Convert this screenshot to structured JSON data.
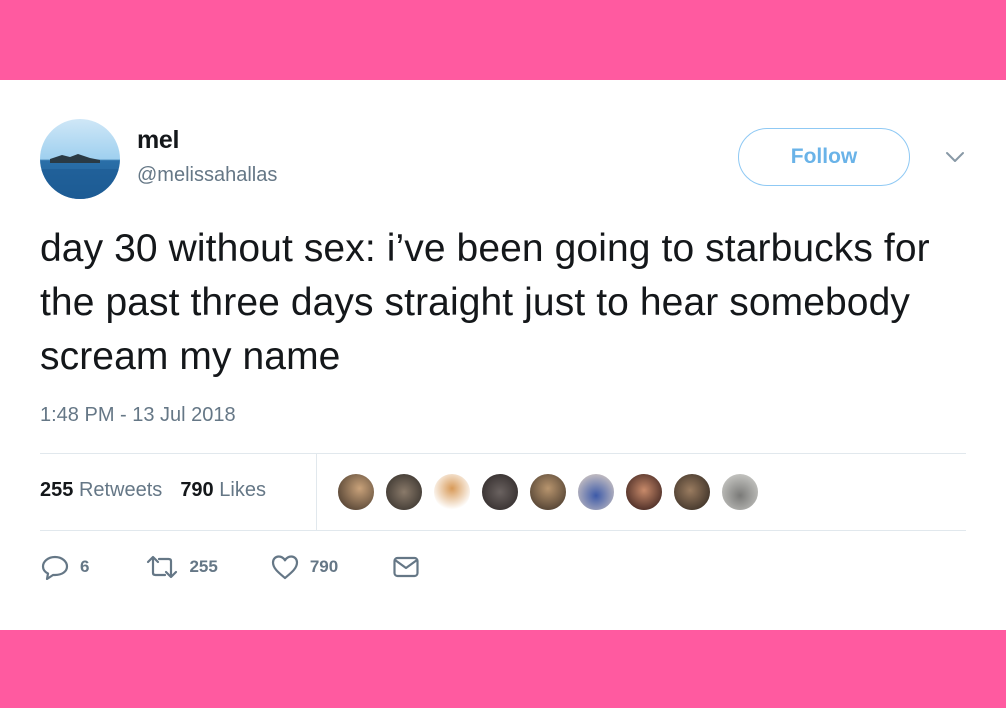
{
  "tweet": {
    "display_name": "mel",
    "handle": "@melissahallas",
    "follow_label": "Follow",
    "text": "day 30 without sex: i’ve been going to starbucks for the past three days straight just to hear somebody scream my name",
    "timestamp": "1:48 PM - 13 Jul 2018"
  },
  "stats": {
    "retweets_count": "255",
    "retweets_label": "Retweets",
    "likes_count": "790",
    "likes_label": "Likes"
  },
  "actions": {
    "reply_count": "6",
    "retweet_count": "255",
    "like_count": "790"
  },
  "colors": {
    "background_pink": "#ff5aa0",
    "follow_blue": "#6ab3e8",
    "muted_gray": "#657786",
    "text_dark": "#14171a"
  },
  "icons": [
    "chevron-down-icon",
    "reply-icon",
    "retweet-icon",
    "heart-icon",
    "message-icon"
  ]
}
